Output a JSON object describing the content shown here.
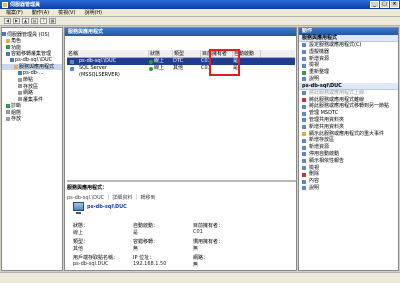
{
  "window": {
    "title": "伺服器管理員"
  },
  "menu": [
    "檔案(F)",
    "動作(A)",
    "檢視(V)",
    "說明(H)"
  ],
  "tree": [
    {
      "label": "伺服器管理員 (OS)",
      "icon": "blue"
    },
    {
      "label": "角色",
      "icon": "yellow"
    },
    {
      "label": "功能",
      "icon": "green"
    },
    {
      "label": "容錯移轉叢集管理",
      "icon": "blue"
    },
    {
      "label": "ps-db-sql.\\DUC",
      "icon": "blue"
    },
    {
      "label": "服務與應用程式",
      "icon": "yellow",
      "selected": true
    },
    {
      "label": "ps-db-...",
      "icon": "blue"
    },
    {
      "label": "節點",
      "icon": "gray"
    },
    {
      "label": "存放區",
      "icon": "gray"
    },
    {
      "label": "網路",
      "icon": "gray"
    },
    {
      "label": "叢集事件",
      "icon": "gray"
    },
    {
      "label": "診斷",
      "icon": "green"
    },
    {
      "label": "組態",
      "icon": "gray"
    },
    {
      "label": "存放",
      "icon": "gray"
    }
  ],
  "center": {
    "header": "服務與應用程式",
    "columns": [
      "名稱",
      "狀態",
      "類型",
      "目前擁有者",
      "自動啟動"
    ],
    "rows": [
      {
        "name": "ps-db-sql.\\DUC",
        "status": "線上",
        "type": "DTC",
        "owner": "C01",
        "auto": "是",
        "selected": true
      },
      {
        "name": "SQL Server (MSSQLSERVER)",
        "status": "線上",
        "type": "其他",
        "owner": "C01",
        "auto": "是"
      }
    ],
    "details": {
      "title": "服務與應用程式：",
      "toolbar": "ps-db-sql.\\DUC ｜ 詳細資料 ｜ 轉移到",
      "name": "ps-db-sql\\DUC",
      "fields": [
        {
          "k": "狀態：",
          "v": "線上"
        },
        {
          "k": "自動啟動：",
          "v": "是"
        },
        {
          "k": "目前擁有者：",
          "v": "C01"
        },
        {
          "k": "類型：",
          "v": "其他"
        },
        {
          "k": "容錯移轉：",
          "v": "無"
        },
        {
          "k": "慣用擁有者：",
          "v": "無"
        },
        {
          "k": "用戶端存取點名稱：",
          "v": "ps-db-sql.DUC"
        },
        {
          "k": "IP 位址：",
          "v": "192.168.1.50"
        },
        {
          "k": "網路：",
          "v": "無"
        }
      ]
    }
  },
  "actions": {
    "header": "動作",
    "sections": [
      {
        "title": "服務與應用程式",
        "items": [
          {
            "label": "設定服務或應用程式(C)",
            "icon": ""
          },
          {
            "label": "虛擬機器",
            "icon": ""
          },
          {
            "label": "新增資源",
            "icon": ""
          },
          {
            "label": "檢視",
            "icon": ""
          },
          {
            "label": "重新整理",
            "icon": "g"
          },
          {
            "label": "說明",
            "icon": ""
          }
        ]
      },
      {
        "title": "ps-db-sql\\DUC",
        "items": [
          {
            "label": "將此服務或應用程式上線",
            "icon": "",
            "disabled": true
          },
          {
            "label": "將此服務或應用程式離線",
            "icon": "r"
          },
          {
            "label": "將此服務或應用程式移轉到另一節點",
            "icon": ""
          },
          {
            "label": "管理 MSDTC",
            "icon": ""
          },
          {
            "label": "管理共用資料夾",
            "icon": ""
          },
          {
            "label": "新增共用資料夾",
            "icon": ""
          },
          {
            "label": "顯示此服務或應用程式的重大事件",
            "icon": "y"
          },
          {
            "label": "新增存放區",
            "icon": ""
          },
          {
            "label": "新增資源",
            "icon": ""
          },
          {
            "label": "停用自動啟動",
            "icon": ""
          },
          {
            "label": "顯示相依性報告",
            "icon": ""
          },
          {
            "label": "檢視",
            "icon": ""
          },
          {
            "label": "刪除",
            "icon": "r"
          },
          {
            "label": "內容",
            "icon": ""
          },
          {
            "label": "說明",
            "icon": ""
          }
        ]
      }
    ]
  }
}
